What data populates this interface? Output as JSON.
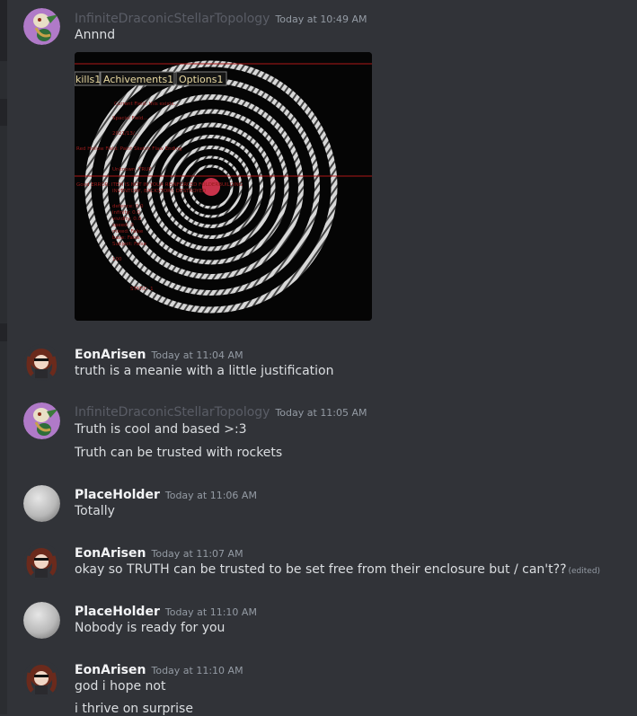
{
  "messages": [
    {
      "author": "InfiniteDraconicStellarTopology",
      "timestamp": "Today at 10:49 AM",
      "lines": [
        "Annnd"
      ],
      "avatar": "snake-avatar"
    },
    {
      "author": "EonArisen",
      "timestamp": "Today at 11:04 AM",
      "lines": [
        "truth is a meanie with a little justification"
      ],
      "avatar": "girl-avatar"
    },
    {
      "author": "InfiniteDraconicStellarTopology",
      "timestamp": "Today at 11:05 AM",
      "lines": [
        "Truth is cool and based >:3",
        "Truth can be trusted with rockets"
      ],
      "avatar": "snake-avatar"
    },
    {
      "author": "PlaceHolder",
      "timestamp": "Today at 11:06 AM",
      "lines": [
        "Totally"
      ],
      "avatar": "gray-orb-avatar"
    },
    {
      "author": "EonArisen",
      "timestamp": "Today at 11:07 AM",
      "lines": [
        "okay so TRUTH can be trusted to be set free from their enclosure but / can't??"
      ],
      "edited": "(edited)",
      "avatar": "girl-avatar"
    },
    {
      "author": "PlaceHolder",
      "timestamp": "Today at 11:10 AM",
      "lines": [
        "Nobody is ready for you"
      ],
      "avatar": "gray-orb-avatar"
    },
    {
      "author": "EonArisen",
      "timestamp": "Today at 11:10 AM",
      "lines": [
        "god i hope not",
        "i thrive on surprise"
      ],
      "avatar": "girl-avatar"
    }
  ],
  "attachment": {
    "tabs": [
      "kills1",
      "Achivements1",
      "Options1"
    ],
    "overlay_text": [
      "Current Field: this exists...",
      "Spacial Field...",
      "2021/13/..",
      "Red Hollow Field: Paint Sketch Flaw Ending",
      "Unknown.   TRUE",
      "Good  ERROR: ITEM IS NOT IN YOUR  REINFORCED FOLDERBUILDING",
      "INVENTORY, BACKSTORY:  DESTROYED",
      "defence: 0.0",
      "infinity: 0.0",
      "vividity: 0.0",
      "speed: 0",
      "mixed: False",
      "base: False",
      "Subject: False",
      "100",
      "STATIC: 1"
    ]
  }
}
